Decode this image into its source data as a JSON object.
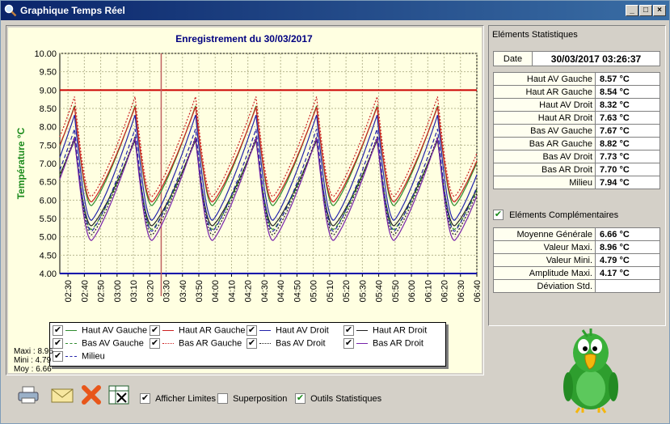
{
  "window": {
    "title": "Graphique Temps Réel",
    "buttons": [
      "_",
      "□",
      "×"
    ]
  },
  "chart": {
    "ylabel": "Température °C",
    "legend": [
      {
        "label": "Haut AV Gauche",
        "color": "#2e8b2e",
        "dash": "solid",
        "checked": true
      },
      {
        "label": "Haut AR Gauche",
        "color": "#cc2222",
        "dash": "solid",
        "checked": true
      },
      {
        "label": "Haut AV Droit",
        "color": "#2222aa",
        "dash": "solid",
        "checked": true
      },
      {
        "label": "Haut AR Droit",
        "color": "#202020",
        "dash": "solid",
        "checked": true
      },
      {
        "label": "Bas AV Gauche",
        "color": "#2e8b2e",
        "dash": "dash",
        "checked": true
      },
      {
        "label": "Bas AR Gauche",
        "color": "#cc2222",
        "dash": "dot",
        "checked": true
      },
      {
        "label": "Bas AV Droit",
        "color": "#202020",
        "dash": "dot",
        "checked": true
      },
      {
        "label": "Bas AR Droit",
        "color": "#7722aa",
        "dash": "solid",
        "checked": true
      },
      {
        "label": "Milieu",
        "color": "#2222aa",
        "dash": "dash",
        "checked": true
      }
    ],
    "minmax": {
      "maxi": "Maxi : 8.96",
      "mini": "Mini : 4.79",
      "moy": "Moy : 6.66"
    }
  },
  "chart_data": {
    "type": "line",
    "title": "Enregistrement du 30/03/2017",
    "ylabel": "Température °C",
    "ylim": [
      4.0,
      10.0
    ],
    "yticks": [
      "10.00",
      "9.50",
      "9.00",
      "8.50",
      "8.00",
      "7.50",
      "7.00",
      "6.50",
      "6.00",
      "5.50",
      "5.00",
      "4.50",
      "4.00"
    ],
    "xticks": [
      "02:30",
      "02:40",
      "02:50",
      "03:00",
      "03:10",
      "03:20",
      "03:30",
      "03:40",
      "03:50",
      "04:00",
      "04:10",
      "04:20",
      "04:30",
      "04:40",
      "04:50",
      "05:00",
      "05:10",
      "05:20",
      "05:30",
      "05:40",
      "05:50",
      "06:00",
      "06:10",
      "06:20",
      "06:30",
      "06:40"
    ],
    "xstart_min": 145,
    "xend_min": 400,
    "cursor_time": "03:27",
    "limits": {
      "high": 9.0,
      "low": 4.0,
      "high_color": "#cc0000",
      "low_color": "#0000aa"
    },
    "cycle_min": 37,
    "cycle_peaks_min": [
      154,
      191,
      228,
      265,
      302,
      339,
      376
    ],
    "series": [
      {
        "name": "Haut AV Gauche",
        "peak": 8.57,
        "trough": 5.85,
        "color": "#2e8b2e",
        "dash": "solid"
      },
      {
        "name": "Haut AR Gauche",
        "peak": 8.54,
        "trough": 5.95,
        "color": "#cc2222",
        "dash": "solid"
      },
      {
        "name": "Haut AV Droit",
        "peak": 8.32,
        "trough": 5.45,
        "color": "#2222aa",
        "dash": "solid"
      },
      {
        "name": "Haut AR Droit",
        "peak": 7.63,
        "trough": 5.3,
        "color": "#202020",
        "dash": "solid"
      },
      {
        "name": "Bas AV Gauche",
        "peak": 7.67,
        "trough": 5.2,
        "color": "#2e8b2e",
        "dash": "dash"
      },
      {
        "name": "Bas AR Gauche",
        "peak": 8.82,
        "trough": 6.1,
        "color": "#cc2222",
        "dash": "dot"
      },
      {
        "name": "Bas AV Droit",
        "peak": 7.73,
        "trough": 5.05,
        "color": "#202020",
        "dash": "dot"
      },
      {
        "name": "Bas AR Droit",
        "peak": 7.7,
        "trough": 4.9,
        "color": "#7722aa",
        "dash": "solid"
      },
      {
        "name": "Milieu",
        "peak": 7.94,
        "trough": 5.15,
        "color": "#2222aa",
        "dash": "dash"
      }
    ]
  },
  "stats": {
    "section_title": "Eléments Statistiques",
    "date_label": "Date",
    "date_value": "30/03/2017 03:26:37",
    "rows": [
      {
        "label": "Haut AV Gauche",
        "value": "8.57 °C"
      },
      {
        "label": "Haut AR Gauche",
        "value": "8.54 °C"
      },
      {
        "label": "Haut AV Droit",
        "value": "8.32 °C"
      },
      {
        "label": "Haut AR Droit",
        "value": "7.63 °C"
      },
      {
        "label": "Bas AV Gauche",
        "value": "7.67 °C"
      },
      {
        "label": "Bas AR Gauche",
        "value": "8.82 °C"
      },
      {
        "label": "Bas AV Droit",
        "value": "7.73 °C"
      },
      {
        "label": "Bas AR Droit",
        "value": "7.70 °C"
      },
      {
        "label": "Milieu",
        "value": "7.94 °C"
      }
    ],
    "complementary_label": "Eléments Complémentaires",
    "complementary_checked": true,
    "complementary": [
      {
        "label": "Moyenne Générale",
        "value": "6.66 °C"
      },
      {
        "label": "Valeur Maxi.",
        "value": "8.96 °C"
      },
      {
        "label": "Valeur Mini.",
        "value": "4.79 °C"
      },
      {
        "label": "Amplitude Maxi.",
        "value": "4.17 °C"
      },
      {
        "label": "Déviation Std.",
        "value": ""
      }
    ]
  },
  "toolbar": {
    "icons": [
      "printer-icon",
      "mail-icon",
      "close-x-icon",
      "excel-icon"
    ],
    "options": [
      {
        "label": "Afficher Limites",
        "checked": true
      },
      {
        "label": "Superposition",
        "checked": false
      },
      {
        "label": "Outils Statistiques",
        "checked": true
      }
    ]
  }
}
